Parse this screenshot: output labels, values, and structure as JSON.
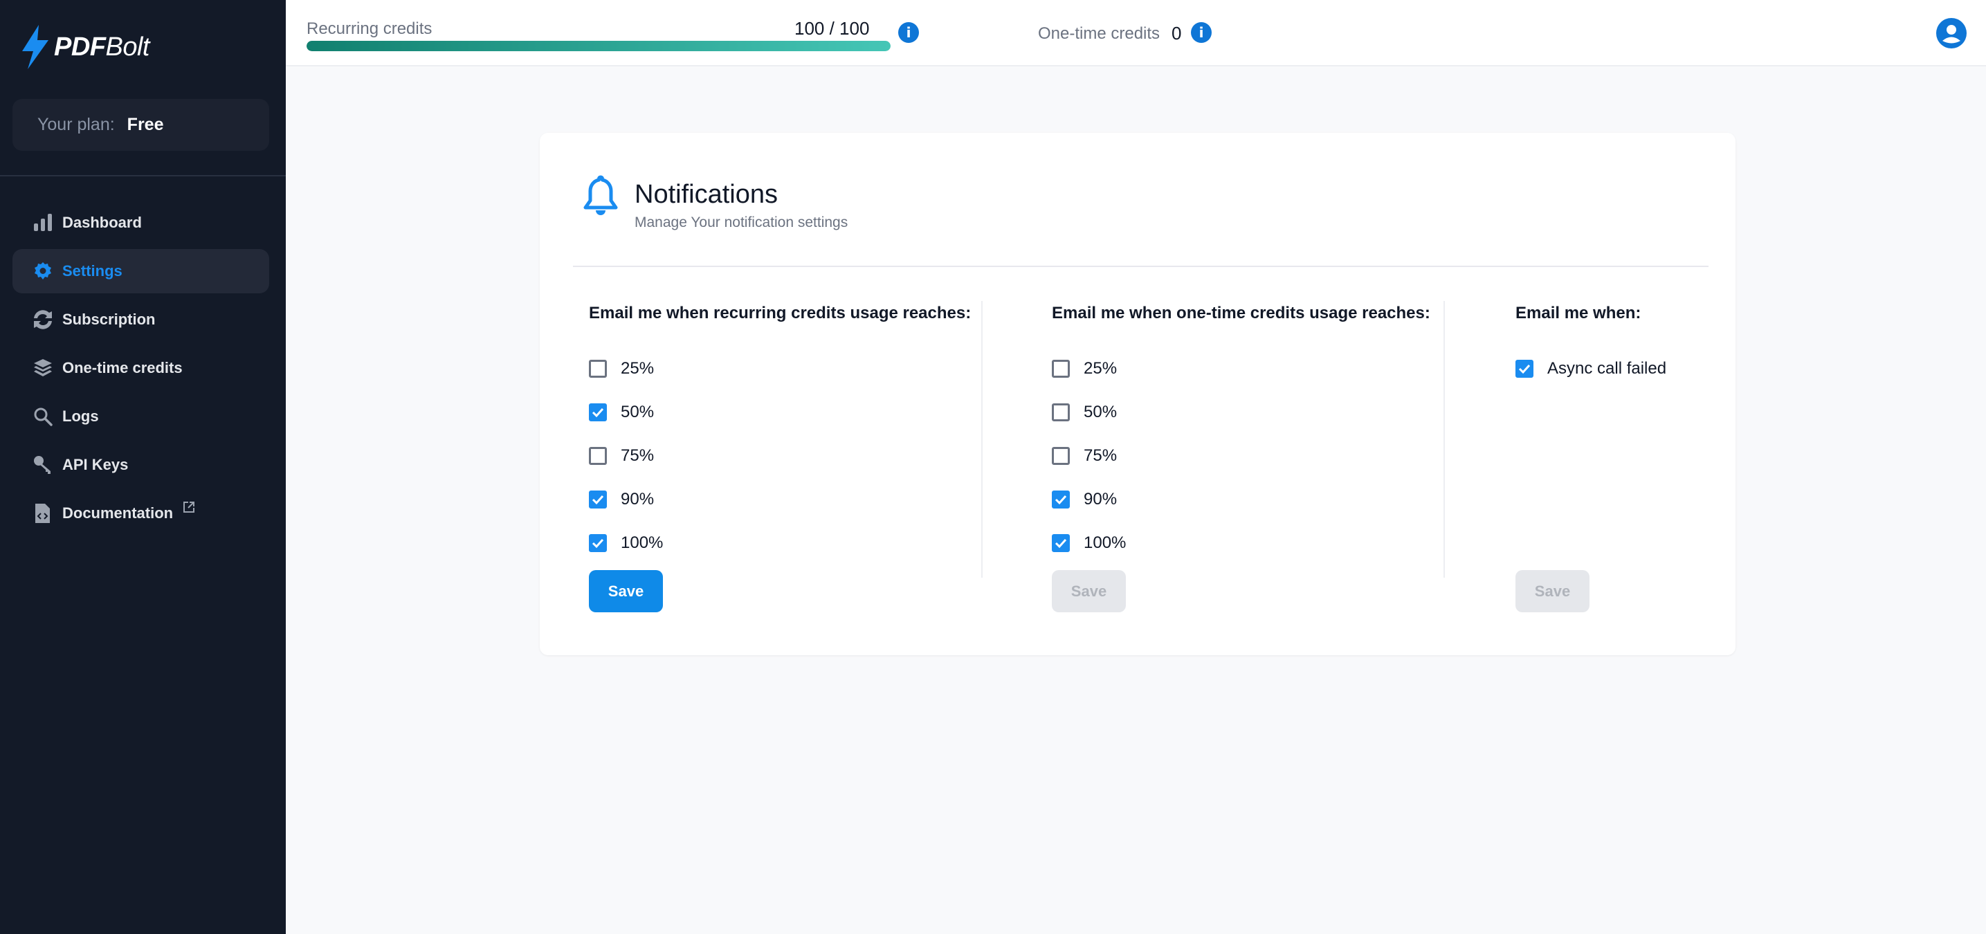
{
  "brand": {
    "name_bold": "PDF",
    "name_light": "Bolt",
    "accent_color": "#1a8cf0"
  },
  "plan": {
    "label": "Your plan:",
    "value": "Free"
  },
  "sidebar": {
    "items": [
      {
        "label": "Dashboard",
        "icon": "bar-chart-icon",
        "active": false
      },
      {
        "label": "Settings",
        "icon": "gear-icon",
        "active": true
      },
      {
        "label": "Subscription",
        "icon": "refresh-icon",
        "active": false
      },
      {
        "label": "One-time credits",
        "icon": "layers-icon",
        "active": false
      },
      {
        "label": "Logs",
        "icon": "search-icon",
        "active": false
      },
      {
        "label": "API Keys",
        "icon": "key-icon",
        "active": false
      },
      {
        "label": "Documentation",
        "icon": "code-file-icon",
        "active": false,
        "external": true
      }
    ]
  },
  "header": {
    "recurring_label": "Recurring credits",
    "recurring_value": "100 / 100",
    "recurring_fraction": 1.0,
    "onetime_label": "One-time credits",
    "onetime_value": "0"
  },
  "notifications": {
    "title": "Notifications",
    "subtitle": "Manage Your notification settings",
    "columns": [
      {
        "title": "Email me when recurring credits usage reaches:",
        "options": [
          {
            "label": "25%",
            "checked": false
          },
          {
            "label": "50%",
            "checked": true
          },
          {
            "label": "75%",
            "checked": false
          },
          {
            "label": "90%",
            "checked": true
          },
          {
            "label": "100%",
            "checked": true
          }
        ],
        "save_label": "Save",
        "save_enabled": true
      },
      {
        "title": "Email me when one-time credits usage reaches:",
        "options": [
          {
            "label": "25%",
            "checked": false
          },
          {
            "label": "50%",
            "checked": false
          },
          {
            "label": "75%",
            "checked": false
          },
          {
            "label": "90%",
            "checked": true
          },
          {
            "label": "100%",
            "checked": true
          }
        ],
        "save_label": "Save",
        "save_enabled": false
      },
      {
        "title": "Email me when:",
        "options": [
          {
            "label": "Async call failed",
            "checked": true
          }
        ],
        "save_label": "Save",
        "save_enabled": false
      }
    ]
  }
}
